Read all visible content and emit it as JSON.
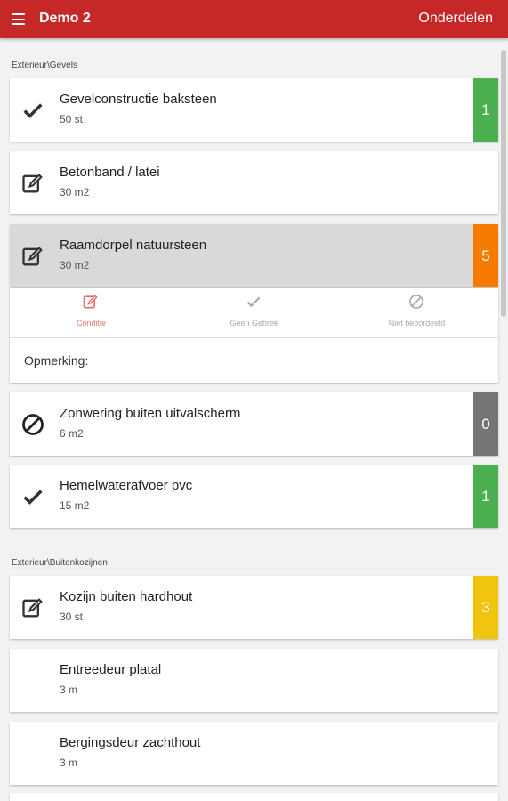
{
  "appbar": {
    "title": "Demo 2",
    "action": "Onderdelen"
  },
  "sections": [
    {
      "header": "Exterieur\\Gevels",
      "items": [
        {
          "name": "Gevelconstructie baksteen",
          "qty": "50 st",
          "icon": "check-icon",
          "badge": "1",
          "badge_color": "#4caf50"
        },
        {
          "name": "Betonband / latei",
          "qty": "30 m2",
          "icon": "edit-icon",
          "badge": "",
          "badge_color": ""
        },
        {
          "name": "Raamdorpel natuursteen",
          "qty": "30 m2",
          "icon": "edit-icon",
          "badge": "5",
          "badge_color": "#f57c00"
        },
        {
          "name": "Zonwering buiten uitvalscherm",
          "qty": "6 m2",
          "icon": "no-entry-icon",
          "badge": "0",
          "badge_color": "#757575"
        },
        {
          "name": "Hemelwaterafvoer pvc",
          "qty": "15 m2",
          "icon": "check-icon",
          "badge": "1",
          "badge_color": "#4caf50"
        }
      ]
    },
    {
      "header": "Exterieur\\Buitenkozijnen",
      "items": [
        {
          "name": "Kozijn buiten hardhout",
          "qty": "30 st",
          "icon": "edit-icon",
          "badge": "3",
          "badge_color": "#f1c40f"
        },
        {
          "name": "Entreedeur platal",
          "qty": "3 m",
          "icon": "",
          "badge": "",
          "badge_color": ""
        },
        {
          "name": "Bergingsdeur zachthout",
          "qty": "3 m",
          "icon": "",
          "badge": "",
          "badge_color": ""
        }
      ]
    }
  ],
  "expanded": {
    "options": [
      {
        "label": "Conditie",
        "icon": "edit-icon"
      },
      {
        "label": "Geen Gebrek",
        "icon": "check-icon"
      },
      {
        "label": "Niet beoordeeld",
        "icon": "no-entry-icon"
      }
    ],
    "remark_label": "Opmerking:"
  },
  "colors": {
    "primary": "#c62828",
    "active": "#e57373"
  }
}
